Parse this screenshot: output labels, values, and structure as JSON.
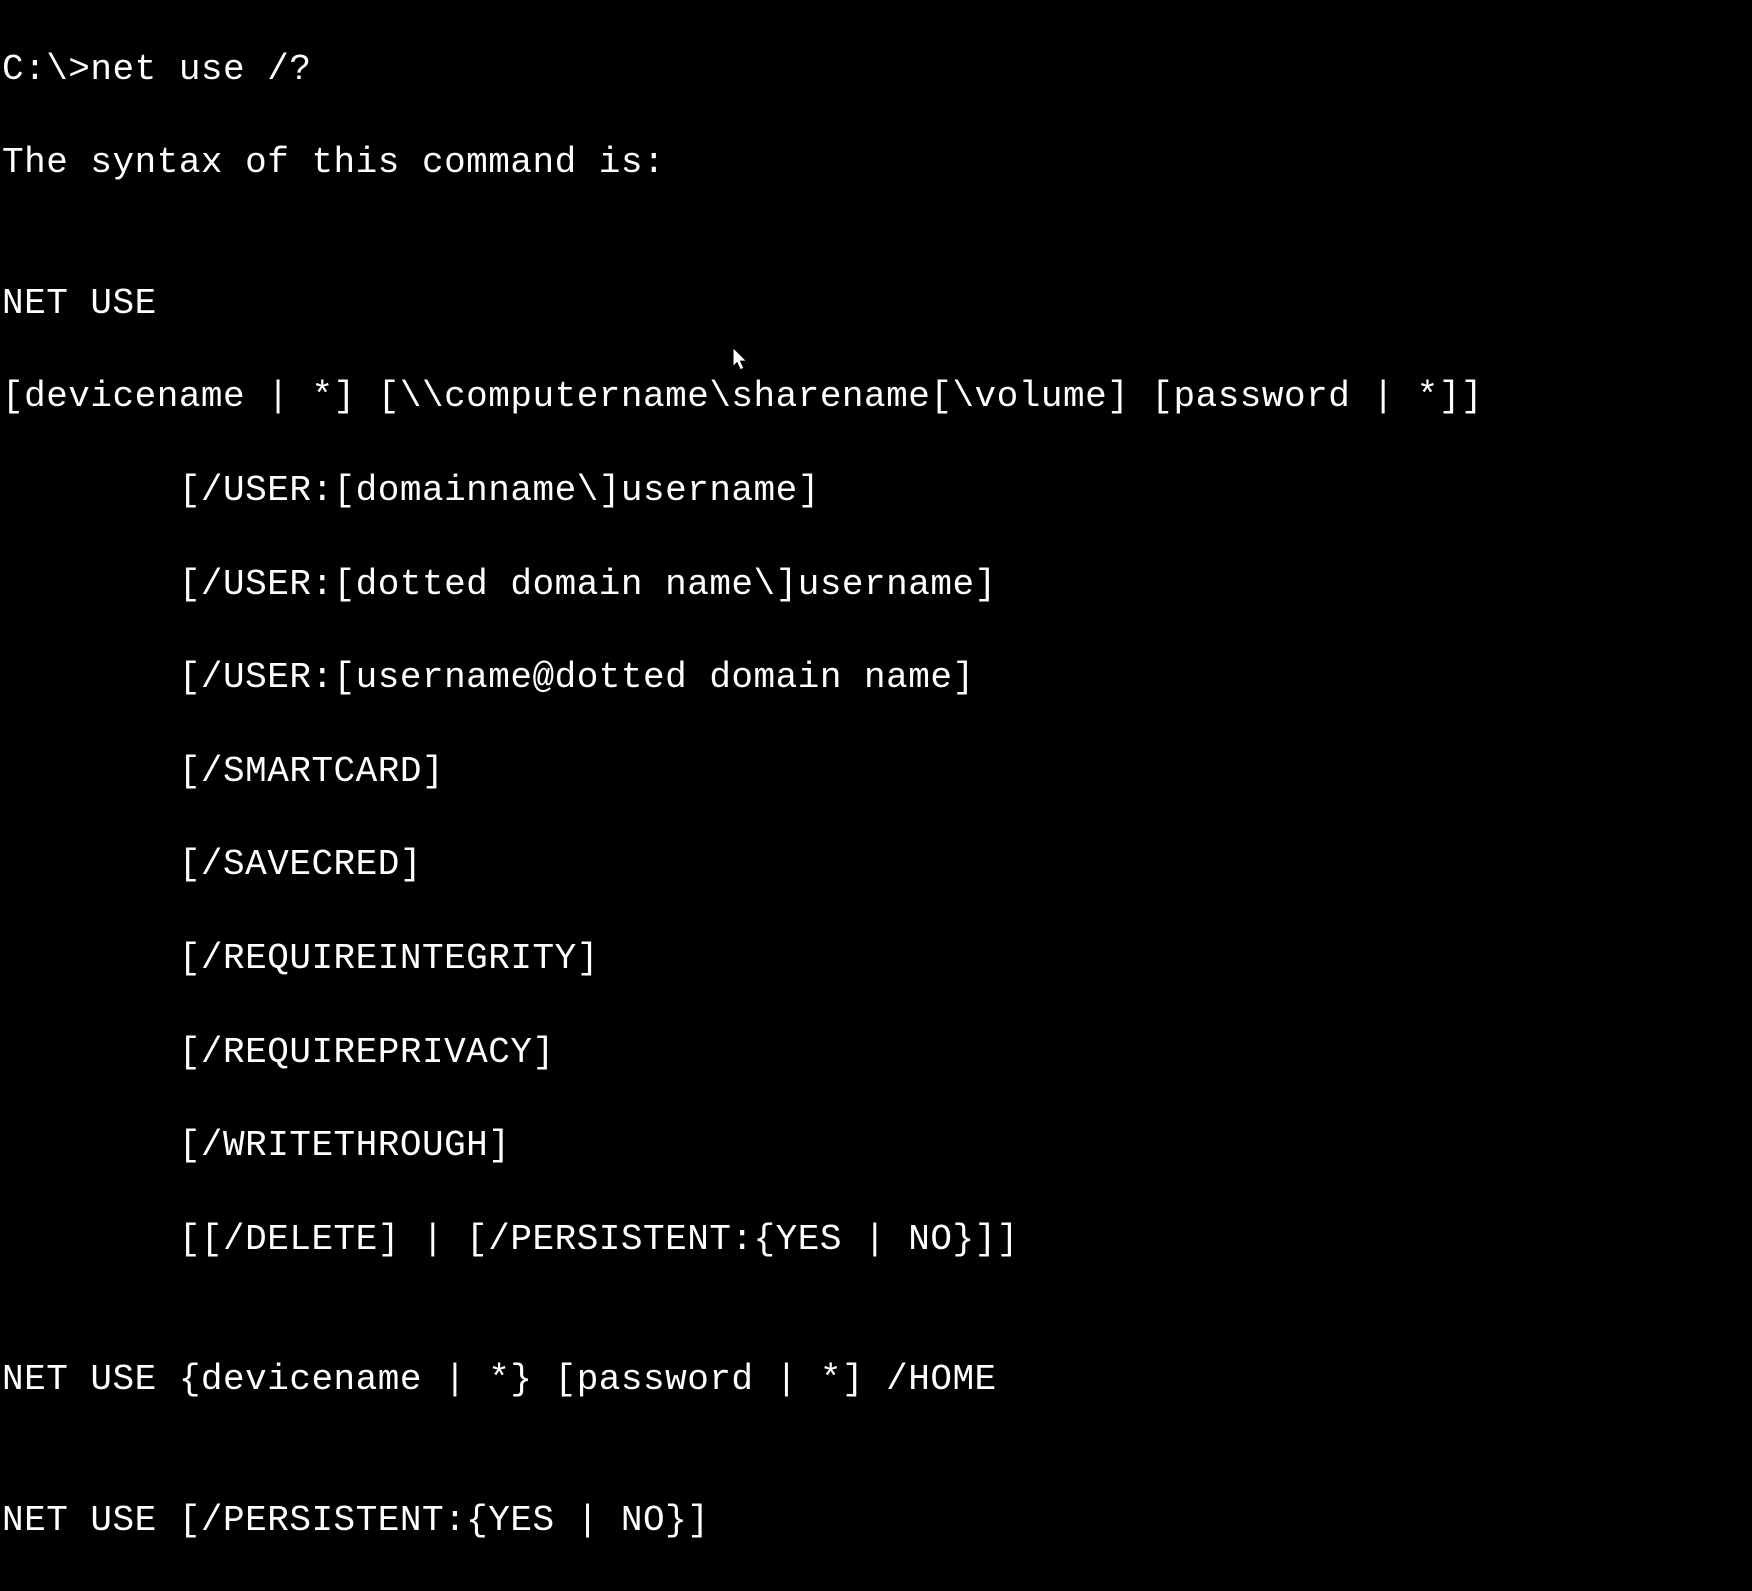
{
  "terminal": {
    "prompt_line": "C:\\>net use /?",
    "intro": "The syntax of this command is:",
    "blank": "",
    "header": "NET USE",
    "syntax_lines": [
      "[devicename | *] [\\\\computername\\sharename[\\volume] [password | *]]",
      "        [/USER:[domainname\\]username]",
      "        [/USER:[dotted domain name\\]username]",
      "        [/USER:[username@dotted domain name]",
      "        [/SMARTCARD]",
      "        [/SAVECRED]",
      "        [/REQUIREINTEGRITY]",
      "        [/REQUIREPRIVACY]",
      "        [/WRITETHROUGH]",
      "        [[/DELETE] | [/PERSISTENT:{YES | NO}]]"
    ],
    "home_line": "NET USE {devicename | *} [password | *] /HOME",
    "persistent_line": "NET USE [/PERSISTENT:{YES | NO}]"
  }
}
